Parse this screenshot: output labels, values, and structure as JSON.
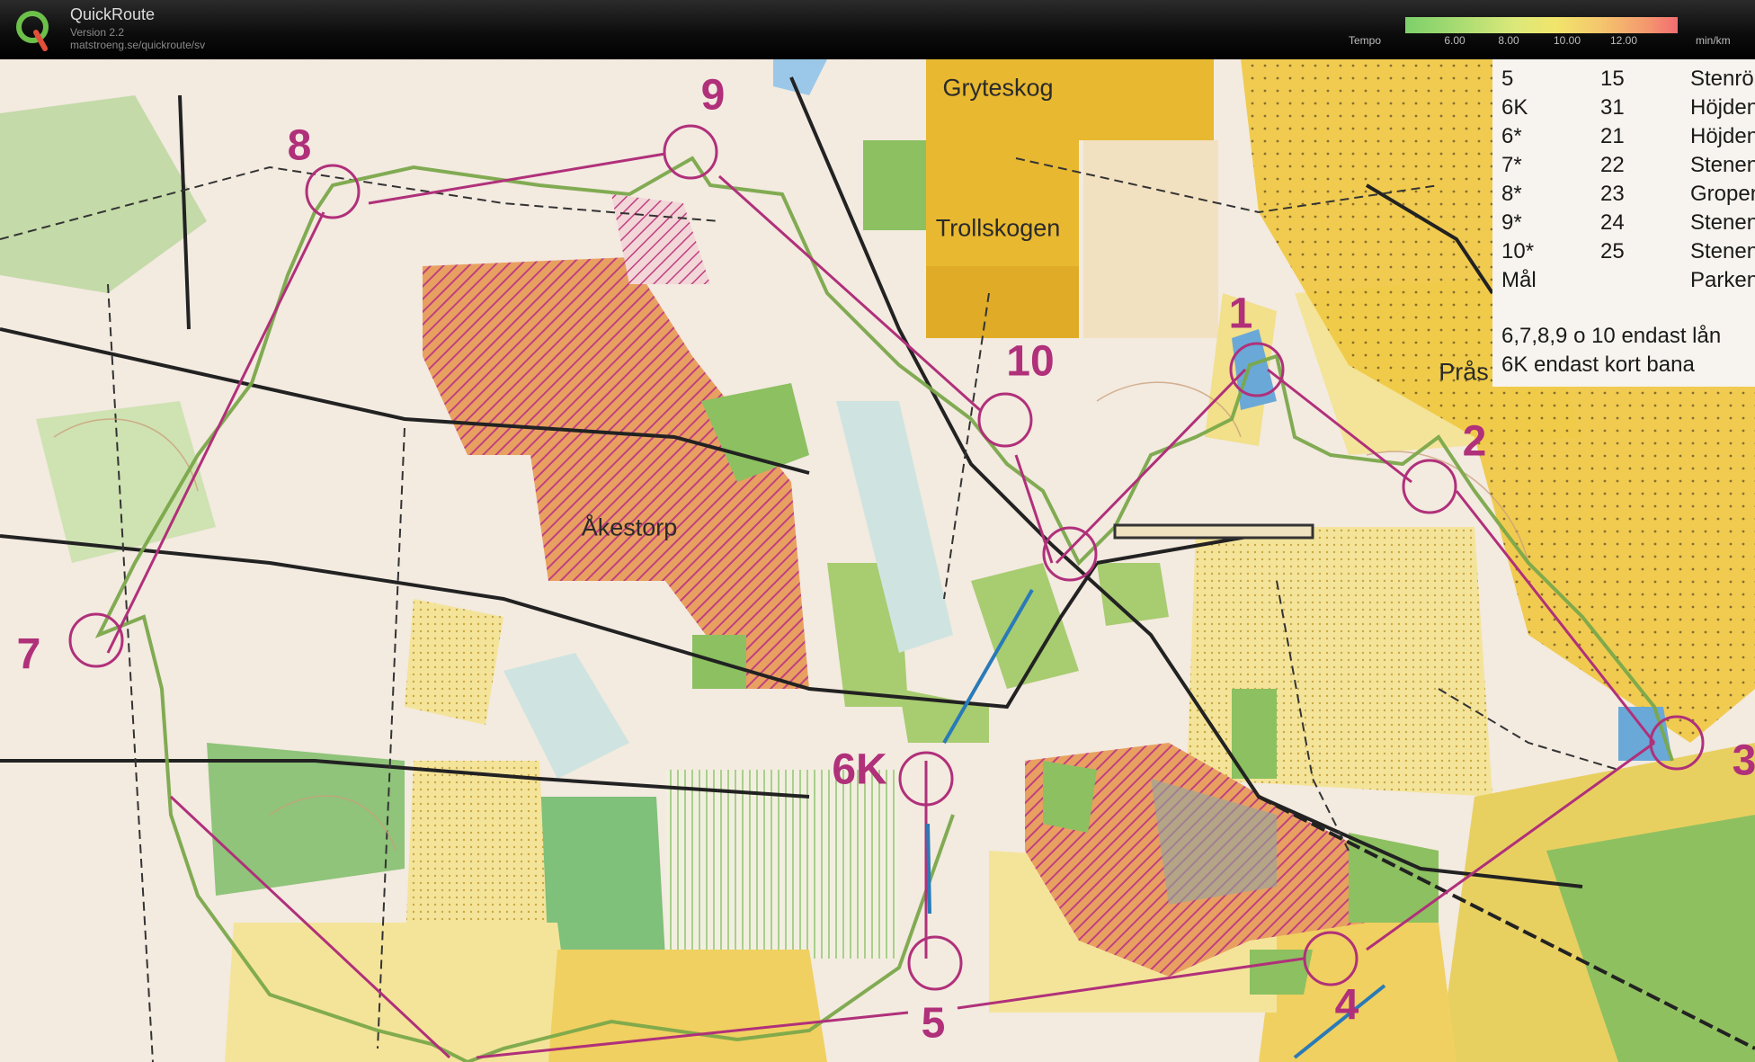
{
  "app": {
    "title": "QuickRoute",
    "version": "Version 2.2",
    "url": "matstroeng.se/quickroute/sv"
  },
  "tempo_legend": {
    "label": "Tempo",
    "ticks": [
      "6.00",
      "8.00",
      "10.00",
      "12.00"
    ],
    "unit": "min/km",
    "colors": [
      "#7dd06a",
      "#dbe87a",
      "#f4c56d",
      "#f36c72"
    ]
  },
  "map": {
    "place_names": {
      "gryteskog": "Gryteskog",
      "trollskogen": "Trollskogen",
      "akestorp": "Åkestorp",
      "pras": "Prås"
    },
    "controls": [
      {
        "label": "1"
      },
      {
        "label": "2"
      },
      {
        "label": "3"
      },
      {
        "label": "4"
      },
      {
        "label": "5"
      },
      {
        "label": "6K"
      },
      {
        "label": "7"
      },
      {
        "label": "8"
      },
      {
        "label": "9"
      },
      {
        "label": "10"
      }
    ],
    "colors": {
      "course": "#b0307a",
      "route": "#7aa84a",
      "forest_green": "#a4c77a",
      "open_yellow": "#f0d85a",
      "orange_hatch": "#e8a060"
    }
  },
  "control_table": {
    "rows": [
      {
        "col1": "5",
        "col2": "15",
        "col3": "Stenrö"
      },
      {
        "col1": "6K",
        "col2": "31",
        "col3": "Höjden"
      },
      {
        "col1": "6*",
        "col2": "21",
        "col3": "Höjden"
      },
      {
        "col1": "7*",
        "col2": "22",
        "col3": "Stenen"
      },
      {
        "col1": "8*",
        "col2": "23",
        "col3": "Gropen"
      },
      {
        "col1": "9*",
        "col2": "24",
        "col3": "Stenen"
      },
      {
        "col1": "10*",
        "col2": "25",
        "col3": "Stenen"
      },
      {
        "col1": "Mål",
        "col2": "",
        "col3": "Parken"
      }
    ],
    "notes": [
      "6,7,8,9 o 10 endast lån",
      "6K endast kort bana"
    ]
  }
}
